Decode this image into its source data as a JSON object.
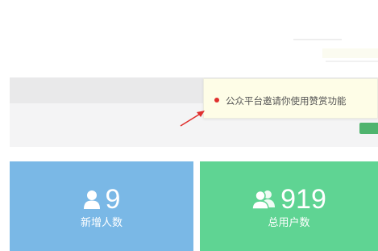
{
  "tooltip": {
    "message": "公众平台邀请你使用赞赏功能",
    "dot_color": "#e0302e"
  },
  "stats": [
    {
      "icon": "user-icon",
      "value": "9",
      "label": "新增人数",
      "color": "#7ab8e6"
    },
    {
      "icon": "users-icon",
      "value": "919",
      "label": "总用户数",
      "color": "#5fd493"
    }
  ]
}
